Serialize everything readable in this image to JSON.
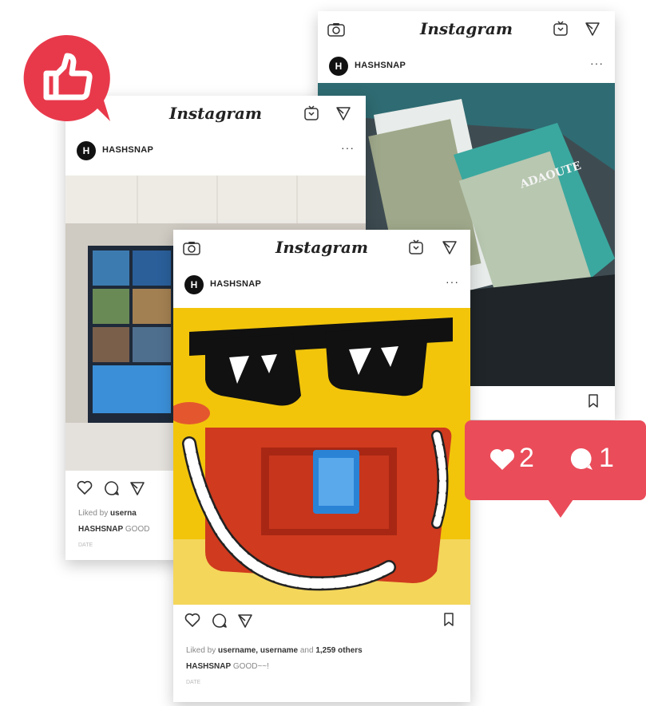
{
  "app_name": "Instagram",
  "icons": [
    "camera-icon",
    "igtv-icon",
    "direct-send-icon",
    "more-options-icon",
    "heart-icon",
    "comment-icon",
    "share-icon",
    "bookmark-icon",
    "thumbs-up-icon"
  ],
  "colors": {
    "accent_red": "#e8394b",
    "notification_red": "#ea4c5a"
  },
  "back_card": {
    "username": "HASHSNAP",
    "avatar_letter": "H",
    "more": "···",
    "photo_text": "ADAOUTE"
  },
  "middle_card": {
    "username": "HASHSNAP",
    "avatar_letter": "H",
    "more": "···",
    "liked_prefix": "Liked by ",
    "liked_user": "userna",
    "caption_user": "HASHSNAP",
    "caption_text": " GOOD",
    "date": "DATE"
  },
  "front_card": {
    "username": "HASHSNAP",
    "avatar_letter": "H",
    "more": "···",
    "liked_prefix": "Liked by ",
    "liked_users": "username, username",
    "liked_and": " and ",
    "liked_others": "1,259 others",
    "caption_user": "HASHSNAP",
    "caption_text": " GOOD~~!",
    "date": "DATE"
  },
  "notification": {
    "likes": "2",
    "comments": "1"
  }
}
